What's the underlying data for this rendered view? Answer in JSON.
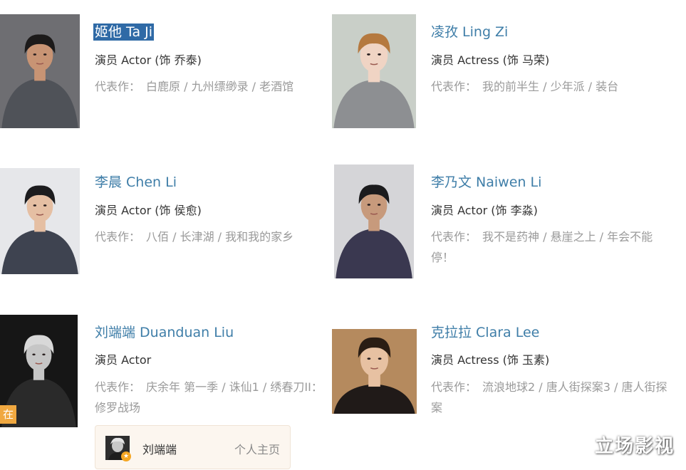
{
  "cast": [
    {
      "name": "姬他 Ta Ji",
      "role": "演员 Actor (饰 乔泰)",
      "works_label": "代表作：",
      "works": "白鹿原 / 九州缥缈录 / 老酒馆",
      "photo_bg": "#6e6e72",
      "skin": "#c89474",
      "hair": "#1c1a1a",
      "cloth": "#4f5258"
    },
    {
      "name": "凌孜 Ling Zi",
      "role": "演员 Actress (饰 马荣)",
      "works_label": "代表作：",
      "works": "我的前半生 / 少年派 / 装台",
      "photo_bg": "#c9cfc8",
      "skin": "#f0d4c4",
      "hair": "#b5793f",
      "cloth": "#8d8f92"
    },
    {
      "name": "李晨 Chen Li",
      "role": "演员 Actor (饰 侯愈)",
      "works_label": "代表作：",
      "works": "八佰 / 长津湖 / 我和我的家乡",
      "photo_bg": "#e6e7ea",
      "skin": "#e5bfa3",
      "hair": "#1c1c1e",
      "cloth": "#3e4350"
    },
    {
      "name": "李乃文 Naiwen Li",
      "role": "演员 Actor (饰 李淼)",
      "works_label": "代表作：",
      "works": "我不是药神 / 悬崖之上 / 年会不能停！",
      "photo_bg": "#d5d5d8",
      "skin": "#c79a7c",
      "hair": "#1b1b1d",
      "cloth": "#3a3850"
    },
    {
      "name": "刘端端 Duanduan Liu",
      "role": "演员 Actor",
      "works_label": "代表作：",
      "works": "庆余年 第一季 / 诛仙1 / 绣春刀II：修罗战场",
      "photo_bg": "#161616",
      "skin": "#c6c6c6",
      "hair": "#d8d8d8",
      "cloth": "#2a2a2a",
      "badge": "在豆瓣"
    },
    {
      "name": "克拉拉 Clara Lee",
      "role": "演员 Actress (饰 玉素)",
      "works_label": "代表作：",
      "works": "流浪地球2 / 唐人街探案3 / 唐人街探案",
      "photo_bg": "#b58a5e",
      "skin": "#e7c1a2",
      "hair": "#2a1d14",
      "cloth": "#201a18"
    }
  ],
  "profile_card": {
    "name": "刘端端",
    "link": "个人主页"
  },
  "watermark": "立场影视"
}
